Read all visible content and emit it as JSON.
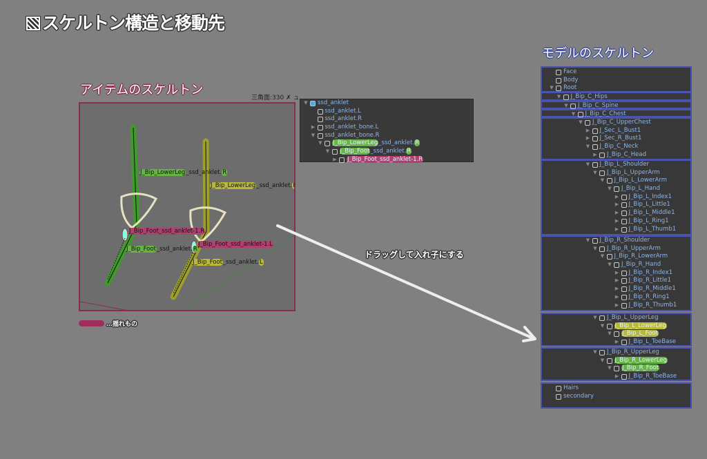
{
  "title": "スケルトン構造と移動先",
  "title_icon": "hatched-square-icon",
  "item_section": {
    "title": "アイテムのスケルトン",
    "triangles": "三角面:330 ✗ ュ",
    "labels": [
      {
        "pre": "J_Bip_LowerLeg",
        "post": "_ssd_anklet.",
        "end": "R",
        "color": "green"
      },
      {
        "pre": "J_Bip_LowerLeg",
        "post": "_ssd_anklet.",
        "end": "L",
        "color": "yellow"
      },
      {
        "pre": "J_Bip_Foot_ssd_anklet-1.R",
        "post": "",
        "end": "",
        "color": "pink"
      },
      {
        "pre": "J_Bip_Foot",
        "post": "_ssd_anklet.",
        "end": "R",
        "color": "green"
      },
      {
        "pre": "J_Bip_Foot_ssd_anklet-1.L",
        "post": "",
        "end": "",
        "color": "pink"
      },
      {
        "pre": "J_Bip_Foot",
        "post": "_ssd_anklet.",
        "end": "L",
        "color": "yellow"
      }
    ],
    "legend": "…揺れもの",
    "colors": {
      "frame": "#8a2b50",
      "green": "#4caf32",
      "yellow": "#b5b530",
      "pink": "#b0416e"
    }
  },
  "item_hierarchy": [
    {
      "label": "ssd_anklet",
      "level": 0,
      "arrow": "down",
      "root": true
    },
    {
      "label": "ssd_anklet.L",
      "level": 1,
      "arrow": ""
    },
    {
      "label": "ssd_anklet.R",
      "level": 1,
      "arrow": ""
    },
    {
      "label": "ssd_anklet_bone.L",
      "level": 1,
      "arrow": "right"
    },
    {
      "label": "ssd_anklet_bone.R",
      "level": 1,
      "arrow": "down"
    },
    {
      "label": "J_Bip_LowerLeg",
      "suffix": "_ssd_anklet.",
      "end": "R",
      "level": 2,
      "arrow": "down",
      "hl": "hg"
    },
    {
      "label": "J_Bip_Foot",
      "suffix": "_ssd_anklet.",
      "end": "R",
      "level": 3,
      "arrow": "down",
      "hl": "hg"
    },
    {
      "label": "J_Bip_Foot_ssd_anklet-1.R",
      "level": 4,
      "arrow": "right",
      "hl": "hp"
    }
  ],
  "drag_hint": "ドラッグして入れ子にする",
  "model_section": {
    "title": "モデルのスケルトン",
    "groups": [
      [
        {
          "label": "Face",
          "level": 0,
          "arrow": ""
        },
        {
          "label": "Body",
          "level": 0,
          "arrow": ""
        },
        {
          "label": "Root",
          "level": 0,
          "arrow": "down"
        }
      ],
      [
        {
          "label": "J_Bip_C_Hips",
          "level": 1,
          "arrow": "down"
        }
      ],
      [
        {
          "label": "J_Bip_C_Spine",
          "level": 2,
          "arrow": "down"
        }
      ],
      [
        {
          "label": "J_Bip_C_Chest",
          "level": 3,
          "arrow": "down"
        }
      ],
      [
        {
          "label": "J_Bip_C_UpperChest",
          "level": 4,
          "arrow": "down"
        },
        {
          "label": "J_Sec_L_Bust1",
          "level": 5,
          "arrow": "right"
        },
        {
          "label": "J_Sec_R_Bust1",
          "level": 5,
          "arrow": "right"
        },
        {
          "label": "J_Bip_C_Neck",
          "level": 5,
          "arrow": "down"
        },
        {
          "label": "J_Bip_C_Head",
          "level": 6,
          "arrow": "right"
        }
      ],
      [
        {
          "label": "J_Bip_L_Shoulder",
          "level": 5,
          "arrow": "down"
        },
        {
          "label": "J_Bip_L_UpperArm",
          "level": 6,
          "arrow": "down"
        },
        {
          "label": "J_Bip_L_LowerArm",
          "level": 7,
          "arrow": "down"
        },
        {
          "label": "J_Bip_L_Hand",
          "level": 8,
          "arrow": "down"
        },
        {
          "label": "J_Bip_L_Index1",
          "level": 9,
          "arrow": "right"
        },
        {
          "label": "J_Bip_L_Little1",
          "level": 9,
          "arrow": "right"
        },
        {
          "label": "J_Bip_L_Middle1",
          "level": 9,
          "arrow": "right"
        },
        {
          "label": "J_Bip_L_Ring1",
          "level": 9,
          "arrow": "right"
        },
        {
          "label": "J_Bip_L_Thumb1",
          "level": 9,
          "arrow": "right"
        }
      ],
      [
        {
          "label": "J_Bip_R_Shoulder",
          "level": 5,
          "arrow": "down"
        },
        {
          "label": "J_Bip_R_UpperArm",
          "level": 6,
          "arrow": "down"
        },
        {
          "label": "J_Bip_R_LowerArm",
          "level": 7,
          "arrow": "down"
        },
        {
          "label": "J_Bip_R_Hand",
          "level": 8,
          "arrow": "down"
        },
        {
          "label": "J_Bip_R_Index1",
          "level": 9,
          "arrow": "right"
        },
        {
          "label": "J_Bip_R_Little1",
          "level": 9,
          "arrow": "right"
        },
        {
          "label": "J_Bip_R_Middle1",
          "level": 9,
          "arrow": "right"
        },
        {
          "label": "J_Bip_R_Ring1",
          "level": 9,
          "arrow": "right"
        },
        {
          "label": "J_Bip_R_Thumb1",
          "level": 9,
          "arrow": "right"
        }
      ],
      [
        {
          "label": "J_Bip_L_UpperLeg",
          "level": 6,
          "arrow": "down"
        },
        {
          "label": "J_Bip_L_LowerLeg",
          "level": 7,
          "arrow": "down",
          "hl": "hy"
        },
        {
          "label": "J_Bip_L_Foot",
          "level": 8,
          "arrow": "down",
          "hl": "hy"
        },
        {
          "label": "J_Bip_L_ToeBase",
          "level": 9,
          "arrow": "right"
        }
      ],
      [
        {
          "label": "J_Bip_R_UpperLeg",
          "level": 6,
          "arrow": "down"
        },
        {
          "label": "J_Bip_R_LowerLeg",
          "level": 7,
          "arrow": "down",
          "hl": "hg"
        },
        {
          "label": "J_Bip_R_Foot",
          "level": 8,
          "arrow": "down",
          "hl": "hg"
        },
        {
          "label": "J_Bip_R_ToeBase",
          "level": 9,
          "arrow": "right"
        }
      ],
      [
        {
          "label": "Hairs",
          "level": 0,
          "arrow": ""
        },
        {
          "label": "secondary",
          "level": 0,
          "arrow": ""
        }
      ]
    ]
  }
}
